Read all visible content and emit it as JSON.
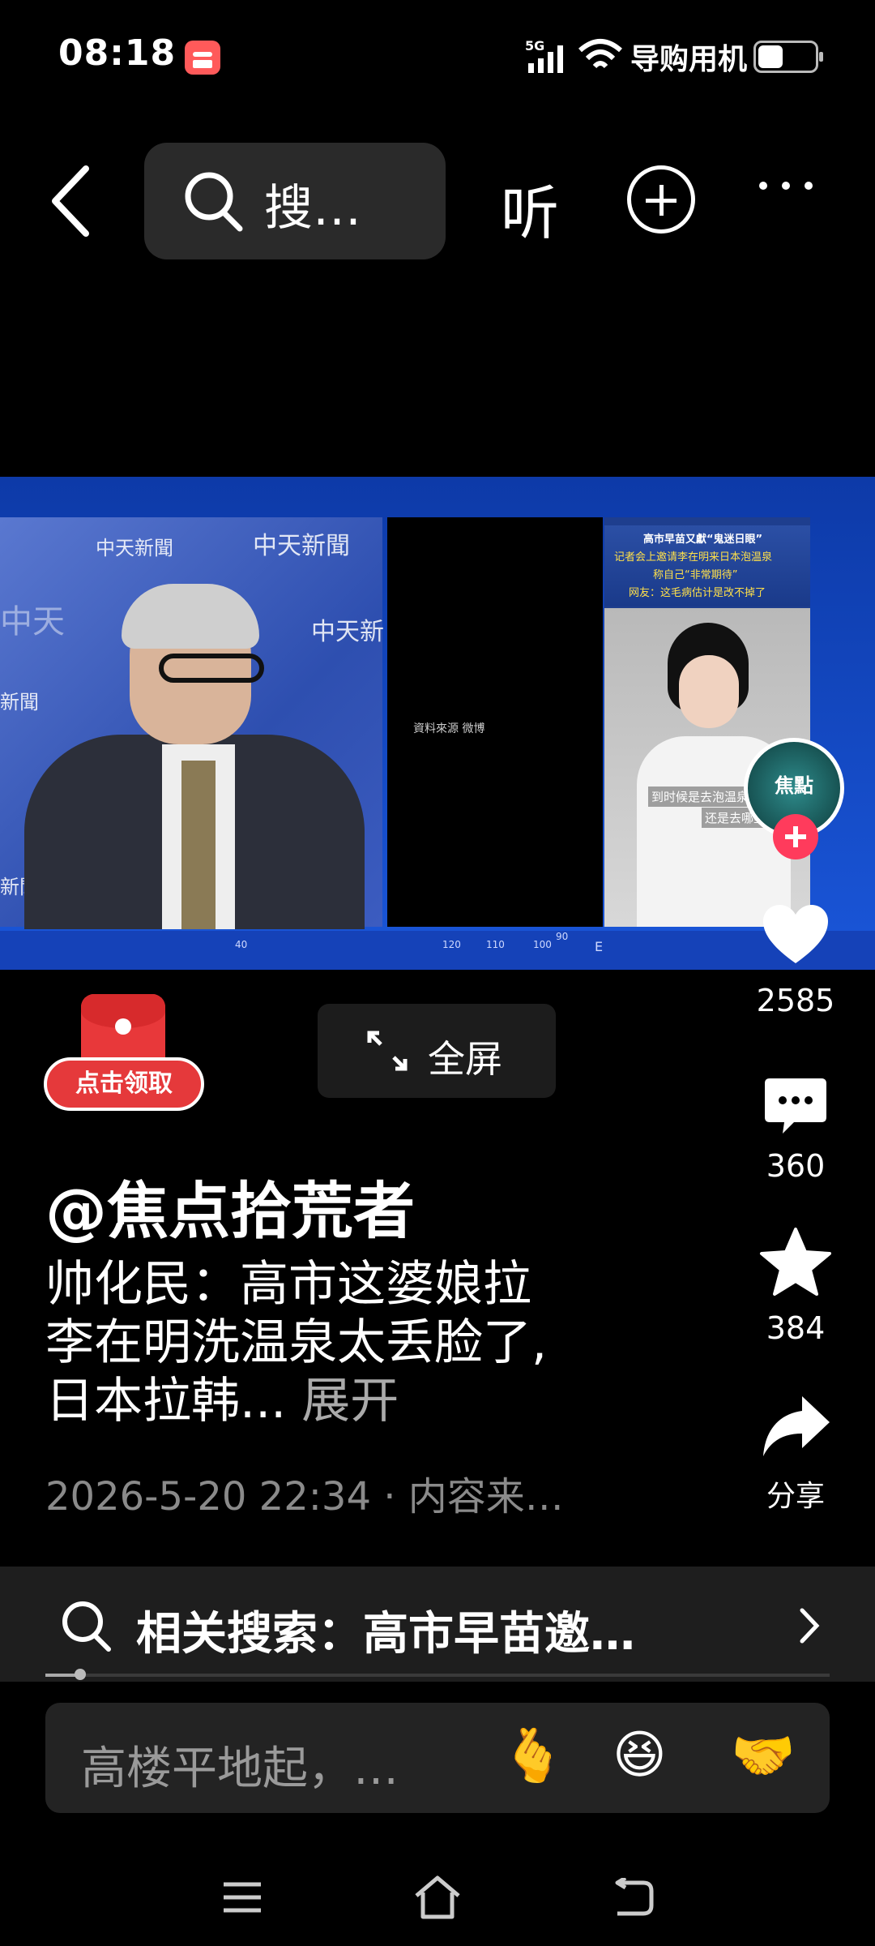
{
  "status_bar": {
    "time": "08:18",
    "network": "5G",
    "carrier": "导购用机"
  },
  "toolbar": {
    "search_text": "搜…",
    "listen_label": "听"
  },
  "video": {
    "channel_labels": [
      "中天新聞",
      "中天新聞",
      "中天新",
      "中天",
      "新聞",
      "新聞"
    ],
    "source_text": "資料來源 微博",
    "inset_headline": [
      "高市早苗又獻“鬼迷日眼”",
      "记者会上邀请李在明来日本泡温泉",
      "称自己“非常期待”",
      "网友：这毛病估计是改不掉了"
    ],
    "inset_subtitle": [
      "到时候是去泡温泉",
      "还是去哪里呢"
    ],
    "channel_logo_text": "焦點",
    "ruler_ticks": [
      "40",
      "120",
      "110",
      "100",
      "90",
      "E"
    ]
  },
  "actions": {
    "likes": "2585",
    "comments": "360",
    "favorites": "384",
    "share_label": "分享"
  },
  "red_packet": {
    "label": "点击领取"
  },
  "fullscreen": {
    "label": "全屏"
  },
  "post": {
    "author": "@焦点拾荒者",
    "description_lines": [
      "帅化民：高市这婆娘拉",
      "李在明洗温泉太丢脸了,",
      "日本拉韩..."
    ],
    "expand_label": "展开",
    "meta": "2026-5-20 22:34 · 内容来…"
  },
  "related_search": {
    "text": "相关搜索：高市早苗邀…"
  },
  "comment_bar": {
    "placeholder": "高楼平地起，…",
    "emojis": [
      "🫰",
      "😆",
      "🤝"
    ]
  },
  "colors": {
    "accent_red": "#e5393b",
    "follow_pink": "#ff3b5c",
    "video_blue": "#1a56d9"
  }
}
